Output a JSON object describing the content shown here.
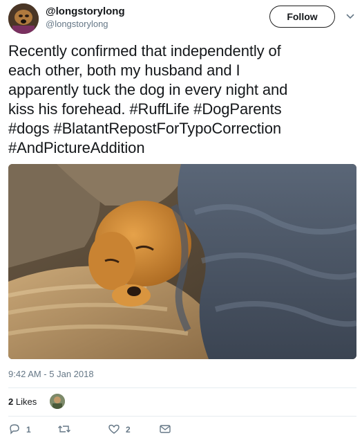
{
  "tweet": {
    "display_name": "@longstorylong",
    "handle": "@longstorylong",
    "follow_label": "Follow",
    "text_lines": [
      "Recently confirmed that independently of",
      "each other, both my husband and I",
      "apparently tuck the dog in every night and",
      "kiss his forehead. #RuffLife #DogParents",
      "#dogs #BlatantRepostForTypoCorrection",
      "#AndPictureAddition"
    ],
    "timestamp": "9:42 AM - 5 Jan 2018",
    "likes_number": "2",
    "likes_word": " Likes",
    "actions": {
      "reply_count": "1",
      "retweet_count": "",
      "like_count": "2"
    }
  },
  "colors": {
    "text": "#14171a",
    "secondary": "#657786",
    "divider": "#e6ecf0"
  },
  "icons": [
    "caret-down-icon",
    "reply-icon",
    "retweet-icon",
    "heart-icon",
    "message-icon"
  ]
}
